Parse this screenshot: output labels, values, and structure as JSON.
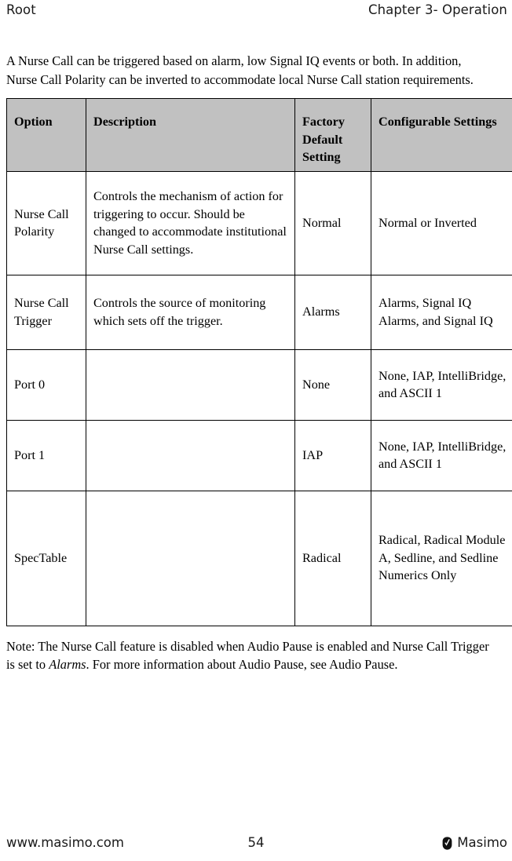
{
  "header": {
    "left": "Root",
    "right": "Chapter 3- Operation"
  },
  "intro": {
    "paragraph": "A Nurse Call can be triggered based on alarm, low Signal IQ events or both. In addition, Nurse Call Polarity can be inverted to accommodate local Nurse Call station requirements."
  },
  "table": {
    "columns": [
      "Option",
      "Description",
      "Factory Default Setting",
      "Configurable Settings"
    ],
    "rows": [
      {
        "option": "Nurse Call Polarity",
        "description": "Controls the mechanism of action for triggering to occur. Should be changed to accommodate institutional Nurse Call settings.",
        "default": "Normal",
        "configurable": "Normal or Inverted"
      },
      {
        "option": "Nurse Call Trigger",
        "description": "Controls the source of monitoring which sets off the trigger.",
        "default": "Alarms",
        "configurable": "Alarms, Signal IQ Alarms, and Signal IQ"
      },
      {
        "option": "Port 0",
        "description": "",
        "default": "None",
        "configurable": "None, IAP, IntelliBridge, and ASCII 1"
      },
      {
        "option": "Port 1",
        "description": "",
        "default": "IAP",
        "configurable": "None, IAP, IntelliBridge, and ASCII 1"
      },
      {
        "option": "SpecTable",
        "description": "",
        "default": "Radical",
        "configurable": "Radical, Radical Module A, Sedline, and Sedline Numerics Only"
      }
    ]
  },
  "note": {
    "part1": "Note: The Nurse Call feature is disabled when Audio Pause is enabled and Nurse Call Trigger is set to ",
    "emphasis": "Alarms",
    "part2": ". For more information about Audio Pause, see Audio Pause."
  },
  "footer": {
    "site": "www.masimo.com",
    "page_number": "54",
    "brand": "Masimo",
    "logo_icon": "masimo-checkmark-icon"
  },
  "colors": {
    "header_fill": "#c1c1c1",
    "text": "#000000",
    "rule": "#000000"
  }
}
